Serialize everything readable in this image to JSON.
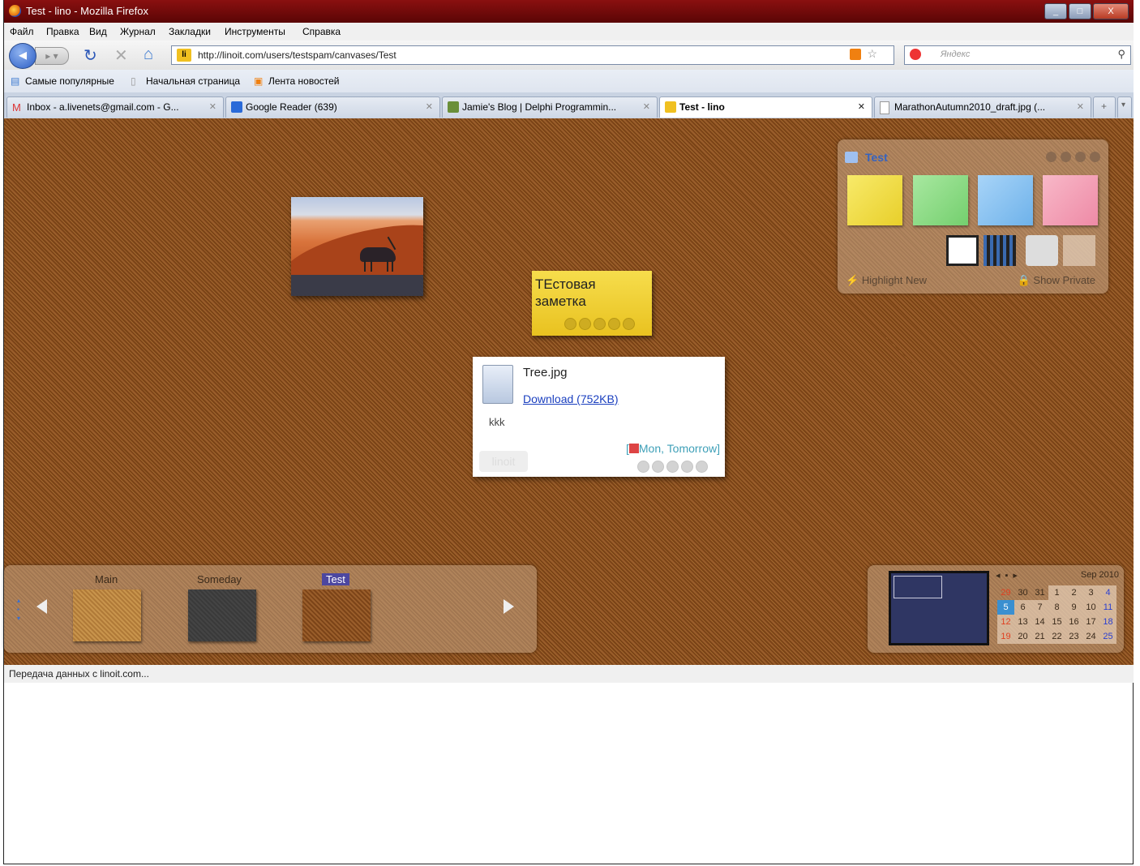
{
  "window": {
    "title": "Test - lino - Mozilla Firefox",
    "buttons": [
      "_",
      "□",
      "X"
    ]
  },
  "menu": [
    "Файл",
    "Правка",
    "Вид",
    "Журнал",
    "Закладки",
    "Инструменты",
    "Справка"
  ],
  "nav": {
    "url": "http://linoit.com/users/testspam/canvases/Test",
    "search_placeholder": "Яндекс",
    "favicon": "li"
  },
  "bookmarks": [
    "Самые популярные",
    "Начальная страница",
    "Лента новостей"
  ],
  "tabs": [
    {
      "label": "Inbox - a.livenets@gmail.com - G...",
      "icon": "gmail-icon",
      "active": false
    },
    {
      "label": "Google Reader (639)",
      "icon": "google-reader-icon",
      "active": false
    },
    {
      "label": "Jamie's Blog | Delphi Programmin...",
      "icon": "blog-icon",
      "active": false
    },
    {
      "label": "Test - lino",
      "icon": "lino-icon",
      "active": true
    },
    {
      "label": "MarathonAutumn2010_draft.jpg (...",
      "icon": "page-icon",
      "active": false
    }
  ],
  "status": "Передача данных с linoit.com...",
  "board": {
    "sticky_note": {
      "text_line1": "ТЕстовая",
      "text_line2": "заметка"
    },
    "file_card": {
      "filename": "Tree.jpg",
      "download": "Download (752KB)",
      "memo": "kkk",
      "due_prefix": "[",
      "due": "Mon, Tomorrow]",
      "watermark": "linoit"
    }
  },
  "palette": {
    "title": "Test",
    "sticky_colors": [
      "#f3e34f",
      "#8fdc8a",
      "#8cc4f4",
      "#f4a3b8"
    ],
    "highlight": "Highlight New",
    "show_private": "Show Private"
  },
  "canvases": [
    {
      "label": "Main",
      "selected": false
    },
    {
      "label": "Someday",
      "selected": false
    },
    {
      "label": "Test",
      "selected": true
    }
  ],
  "calendar": {
    "month": "Sep 2010",
    "rows": [
      [
        "29",
        "30",
        "31",
        "1",
        "2",
        "3",
        "4"
      ],
      [
        "5",
        "6",
        "7",
        "8",
        "9",
        "10",
        "11"
      ],
      [
        "12",
        "13",
        "14",
        "15",
        "16",
        "17",
        "18"
      ],
      [
        "19",
        "20",
        "21",
        "22",
        "23",
        "24",
        "25"
      ]
    ]
  }
}
